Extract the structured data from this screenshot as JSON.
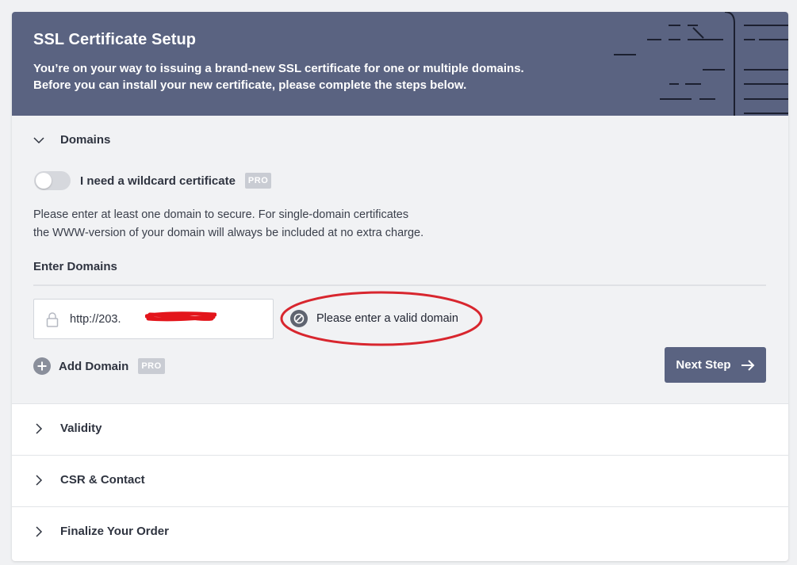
{
  "header": {
    "title": "SSL Certificate Setup",
    "line1": "You’re on your way to issuing a brand-new SSL certificate for one or multiple domains.",
    "line2": "Before you can install your new certificate, please complete the steps below."
  },
  "domains_section": {
    "title": "Domains",
    "wildcard_label": "I need a wildcard certificate",
    "wildcard_enabled": false,
    "pro_badge": "PRO",
    "info_line1": "Please enter at least one domain to secure. For single-domain certificates",
    "info_line2": "the WWW-version of your domain will always be included at no extra charge.",
    "enter_label": "Enter Domains",
    "domain_value": "http://203.",
    "error_text": "Please enter a valid domain",
    "add_domain_label": "Add Domain",
    "add_pro_badge": "PRO",
    "next_label": "Next Step"
  },
  "sections": [
    {
      "title": "Validity"
    },
    {
      "title": "CSR & Contact"
    },
    {
      "title": "Finalize Your Order"
    }
  ],
  "colors": {
    "header_bg": "#5a6381",
    "panel_bg": "#f1f2f4",
    "annotation_red": "#d8262e",
    "pro_badge_bg": "#c9ccd3"
  }
}
